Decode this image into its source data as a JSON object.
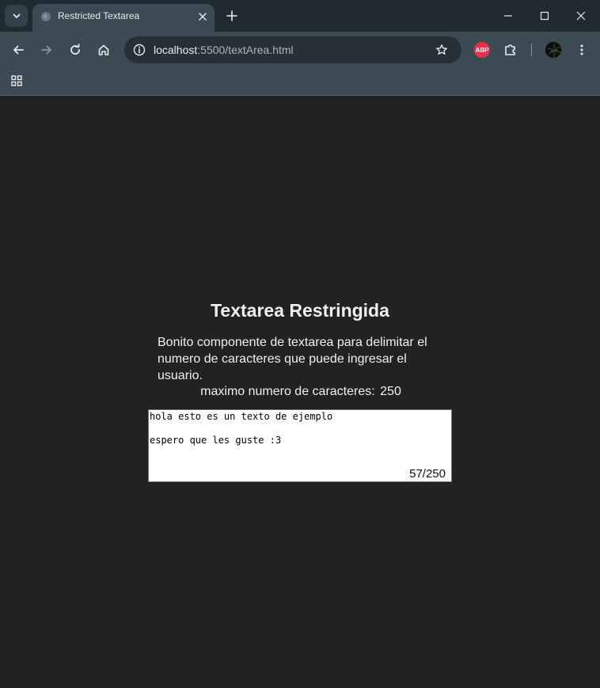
{
  "browser": {
    "tab": {
      "title": "Restricted Textarea"
    },
    "url": {
      "host": "localhost",
      "rest": ":5500/textArea.html"
    },
    "icons": {
      "tab_search": "chevron-down-icon",
      "tab_favicon": "globe-icon",
      "tab_close": "close-icon",
      "new_tab": "plus-icon",
      "minimize": "minimize-icon",
      "maximize": "maximize-icon",
      "close": "close-icon",
      "back": "back-arrow-icon",
      "forward": "forward-arrow-icon",
      "reload": "reload-icon",
      "home": "home-icon",
      "site_info": "info-icon",
      "bookmark": "star-icon",
      "extensions": "puzzle-icon",
      "menu": "kebab-menu-icon",
      "apps": "apps-grid-icon"
    },
    "extension_abp": {
      "label": "ABP",
      "color": "#e8304a"
    }
  },
  "page": {
    "title": "Textarea Restringida",
    "description": "Bonito componente de textarea para delimitar el numero de caracteres que puede ingresar el usuario.",
    "max_label": "maximo numero de caracteres:",
    "max_value": "250",
    "textarea_value": "hola esto es un texto de ejemplo\n\nespero que les guste :3",
    "counter": "57/250"
  },
  "colors": {
    "page_background": "#222222",
    "toolbar": "#3b4a53",
    "tabstrip": "#202a31",
    "text": "#f0f0f0"
  }
}
